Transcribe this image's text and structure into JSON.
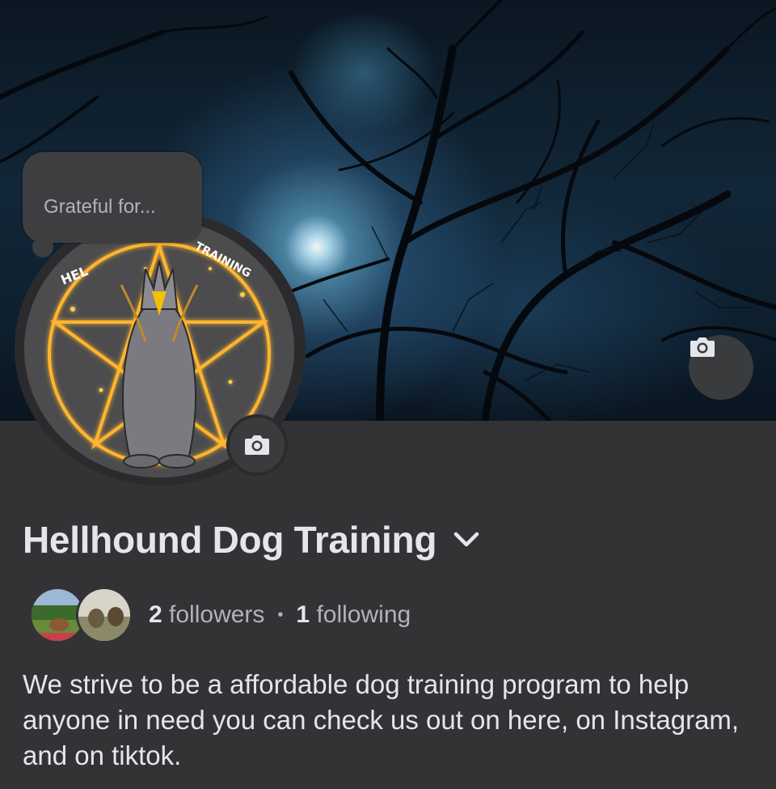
{
  "note": {
    "text": "Grateful for..."
  },
  "logo": {
    "left_text": "HEL",
    "right_text": "TRAINING"
  },
  "page": {
    "name": "Hellhound Dog Training",
    "followers_count": "2",
    "followers_label": "followers",
    "separator": "•",
    "following_count": "1",
    "following_label": "following",
    "bio": "We strive to be a affordable dog training program to help anyone in need you can check us out on here, on Instagram, and on tiktok."
  },
  "icons": {
    "cover_camera": "camera-icon",
    "avatar_camera": "camera-icon",
    "name_dropdown": "chevron-down-icon"
  },
  "colors": {
    "background": "#333335",
    "button_bg": "#3a3b3c",
    "text_primary": "#e4e6eb",
    "text_secondary": "#b0b3b8",
    "logo_glow": "#ffb300"
  }
}
